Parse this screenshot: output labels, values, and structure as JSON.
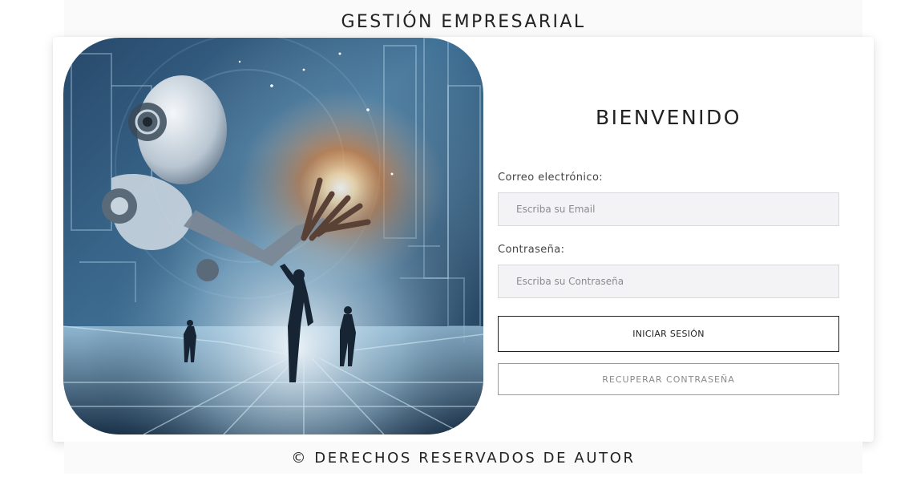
{
  "header": {
    "title": "GESTIÓN EMPRESARIAL"
  },
  "hero": {
    "image": "ai-robot-hand-illustration"
  },
  "login": {
    "title": "BIENVENIDO",
    "email_label": "Correo electrónico:",
    "email_placeholder": "Escriba su Email",
    "password_label": "Contraseña:",
    "password_placeholder": "Escriba su Contraseña",
    "submit_label": "INICIAR SESIÓN",
    "recover_label": "RECUPERAR CONTRASEÑA"
  },
  "footer": {
    "text": "© DERECHOS RESERVADOS DE AUTOR"
  },
  "colors": {
    "text": "#222222",
    "input_bg": "#f3f3f5",
    "secondary_text": "#8a8a8a"
  }
}
